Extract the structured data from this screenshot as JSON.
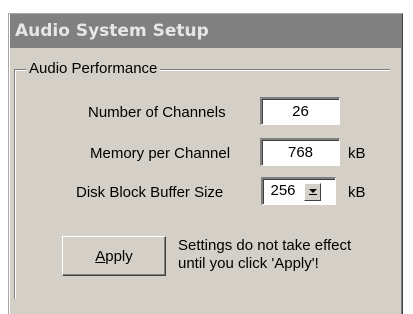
{
  "window": {
    "title": "Audio System Setup"
  },
  "group": {
    "label": "Audio Performance"
  },
  "channels": {
    "label": "Number of Channels",
    "value": "26"
  },
  "memory": {
    "label": "Memory per Channel",
    "value": "768",
    "unit": "kB"
  },
  "disk_buffer": {
    "label": "Disk Block Buffer Size",
    "value": "256",
    "unit": "kB"
  },
  "apply": {
    "label": "Apply",
    "note_line1": "Settings do not take effect",
    "note_line2": "until you click 'Apply'!"
  },
  "colors": {
    "title_bar": "#808080",
    "title_text": "#e6e6e6",
    "face": "#d4d0c8"
  },
  "icons": {
    "spin": "down-arrow-icon"
  }
}
